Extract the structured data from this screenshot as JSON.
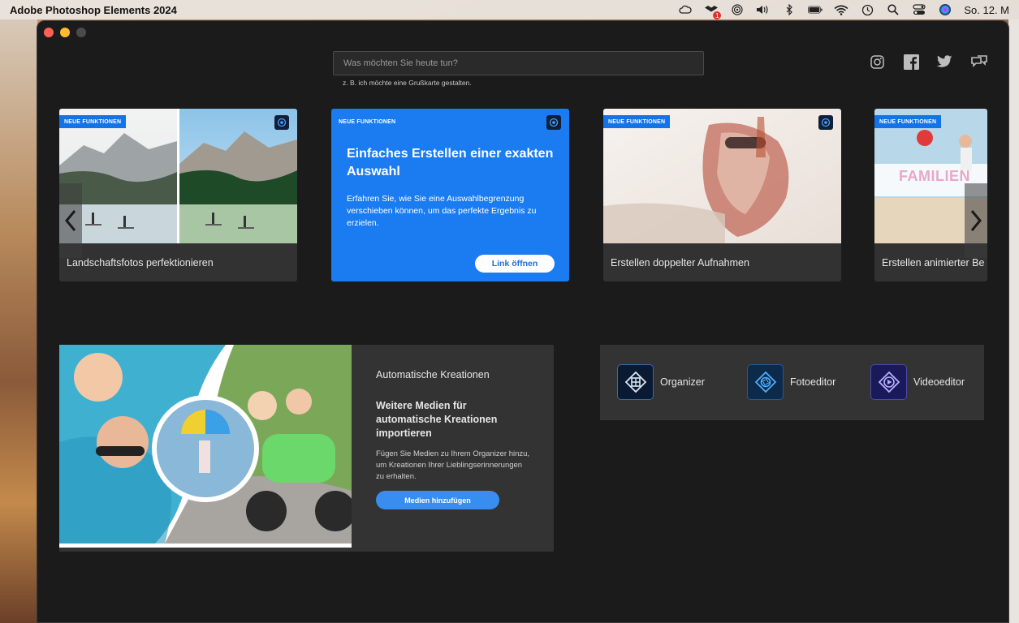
{
  "menubar": {
    "app_title": "Adobe Photoshop Elements 2024",
    "clock": "So. 12. M",
    "dropbox_badge": "1",
    "icons": [
      "creative-cloud-icon",
      "dropbox-icon",
      "airdrop-icon",
      "volume-icon",
      "bluetooth-icon",
      "battery-icon",
      "wifi-icon",
      "time-machine-icon",
      "search-icon",
      "control-center-icon",
      "siri-icon"
    ]
  },
  "search": {
    "placeholder": "Was möchten Sie heute tun?",
    "hint": "z. B. ich möchte eine Grußkarte gestalten."
  },
  "social": [
    "instagram-icon",
    "facebook-icon",
    "twitter-icon",
    "feedback-icon"
  ],
  "carousel": {
    "badge": "NEUE FUNKTIONEN",
    "cards": [
      {
        "label": "Landschaftsfotos perfektionieren"
      },
      {
        "title": "Einfaches Erstellen einer exakten Auswahl",
        "description": "Erfahren Sie, wie Sie eine Auswahlbegrenzung verschieben können, um das perfekte Ergebnis zu erzielen.",
        "button": "Link öffnen"
      },
      {
        "label": "Erstellen doppelter Aufnahmen"
      },
      {
        "label": "Erstellen animierter Be",
        "overlay_text": "FAMILIEN"
      }
    ]
  },
  "auto_creations": {
    "heading": "Automatische Kreationen",
    "title": "Weitere Medien für automatische Kreationen importieren",
    "description": "Fügen Sie Medien zu Ihrem Organizer hinzu, um Kreationen Ihrer Lieblingserinnerungen zu erhalten.",
    "button": "Medien hinzufügen"
  },
  "editors": [
    {
      "label": "Organizer",
      "color": "#0a1a33"
    },
    {
      "label": "Fotoeditor",
      "color": "#0e2a4a"
    },
    {
      "label": "Videoeditor",
      "color": "#1a1a5a"
    }
  ],
  "colors": {
    "accent": "#1473e6",
    "card_blue": "#1a7cf0",
    "button_blue": "#378ef0"
  }
}
